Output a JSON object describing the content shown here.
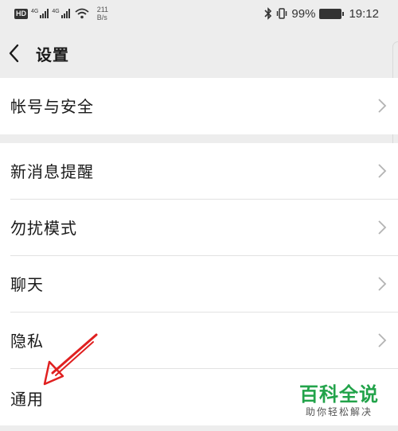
{
  "status_bar": {
    "hd_badge": "HD",
    "net1": "4G",
    "net2": "4G",
    "speed_value": "211",
    "speed_unit": "B/s",
    "battery_percent": "99%",
    "time": "19:12"
  },
  "header": {
    "title": "设置"
  },
  "sections": [
    {
      "items": [
        {
          "label": "帐号与安全"
        }
      ]
    },
    {
      "items": [
        {
          "label": "新消息提醒"
        },
        {
          "label": "勿扰模式"
        },
        {
          "label": "聊天"
        },
        {
          "label": "隐私"
        },
        {
          "label": "通用"
        }
      ]
    }
  ],
  "annotation": {
    "arrow_color": "#e02020"
  },
  "watermark": {
    "title": "百科全说",
    "subtitle": "助你轻松解决"
  }
}
